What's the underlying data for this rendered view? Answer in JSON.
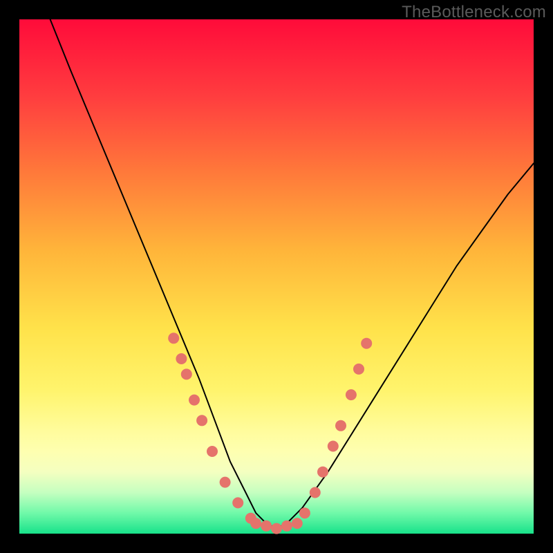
{
  "watermark": "TheBottleneck.com",
  "chart_data": {
    "type": "line",
    "title": "",
    "xlabel": "",
    "ylabel": "",
    "xlim": [
      0,
      100
    ],
    "ylim": [
      0,
      100
    ],
    "grid": false,
    "legend": false,
    "series": [
      {
        "name": "bottleneck-curve",
        "x": [
          6,
          10,
          15,
          20,
          25,
          30,
          35,
          38,
          41,
          44,
          46,
          48,
          50,
          52,
          55,
          60,
          65,
          70,
          75,
          80,
          85,
          90,
          95,
          100
        ],
        "y": [
          100,
          90,
          78,
          66,
          54,
          42,
          30,
          22,
          14,
          8,
          4,
          2,
          1,
          2,
          5,
          12,
          20,
          28,
          36,
          44,
          52,
          59,
          66,
          72
        ],
        "stroke": "#000000",
        "stroke_width": 2
      }
    ],
    "scatter": [
      {
        "name": "left-dots",
        "color": "#e5736b",
        "radius": 8,
        "points": [
          {
            "x": 30.0,
            "y": 38
          },
          {
            "x": 31.5,
            "y": 34
          },
          {
            "x": 32.5,
            "y": 31
          },
          {
            "x": 34.0,
            "y": 26
          },
          {
            "x": 35.5,
            "y": 22
          },
          {
            "x": 37.5,
            "y": 16
          },
          {
            "x": 40.0,
            "y": 10
          },
          {
            "x": 42.5,
            "y": 6
          },
          {
            "x": 45.0,
            "y": 3
          }
        ]
      },
      {
        "name": "bottom-dots",
        "color": "#e5736b",
        "radius": 8,
        "points": [
          {
            "x": 46.0,
            "y": 2
          },
          {
            "x": 48.0,
            "y": 1.5
          },
          {
            "x": 50.0,
            "y": 1
          },
          {
            "x": 52.0,
            "y": 1.5
          },
          {
            "x": 54.0,
            "y": 2
          }
        ]
      },
      {
        "name": "right-dots",
        "color": "#e5736b",
        "radius": 8,
        "points": [
          {
            "x": 55.5,
            "y": 4
          },
          {
            "x": 57.5,
            "y": 8
          },
          {
            "x": 59.0,
            "y": 12
          },
          {
            "x": 61.0,
            "y": 17
          },
          {
            "x": 62.5,
            "y": 21
          },
          {
            "x": 64.5,
            "y": 27
          },
          {
            "x": 66.0,
            "y": 32
          },
          {
            "x": 67.5,
            "y": 37
          }
        ]
      }
    ]
  }
}
